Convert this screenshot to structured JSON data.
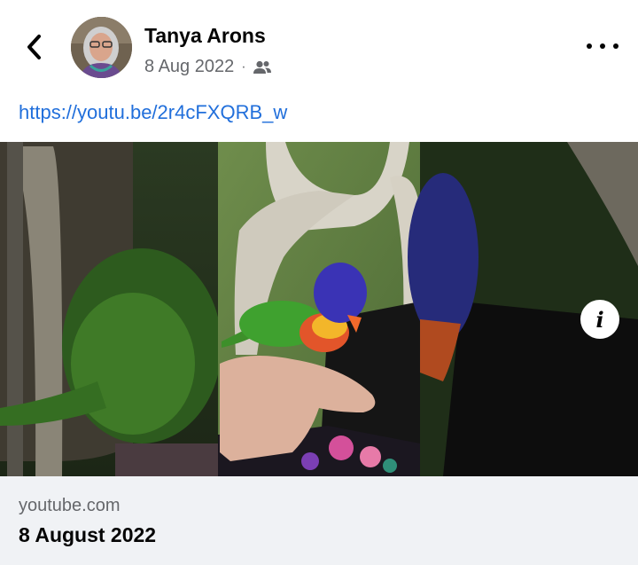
{
  "post": {
    "author": "Tanya Arons",
    "date": "8 Aug 2022",
    "separator": "·",
    "audience_icon": "friends-icon",
    "link_text": "https://youtu.be/2r4cFXQRB_w"
  },
  "header": {
    "back_icon": "chevron-left-icon",
    "more_icon": "more-horizontal-icon"
  },
  "media": {
    "info_label": "i"
  },
  "preview": {
    "domain": "youtube.com",
    "title": "8 August 2022"
  },
  "colors": {
    "link": "#216fdb",
    "footer_bg": "#f0f2f5",
    "secondary_text": "#65676b"
  }
}
